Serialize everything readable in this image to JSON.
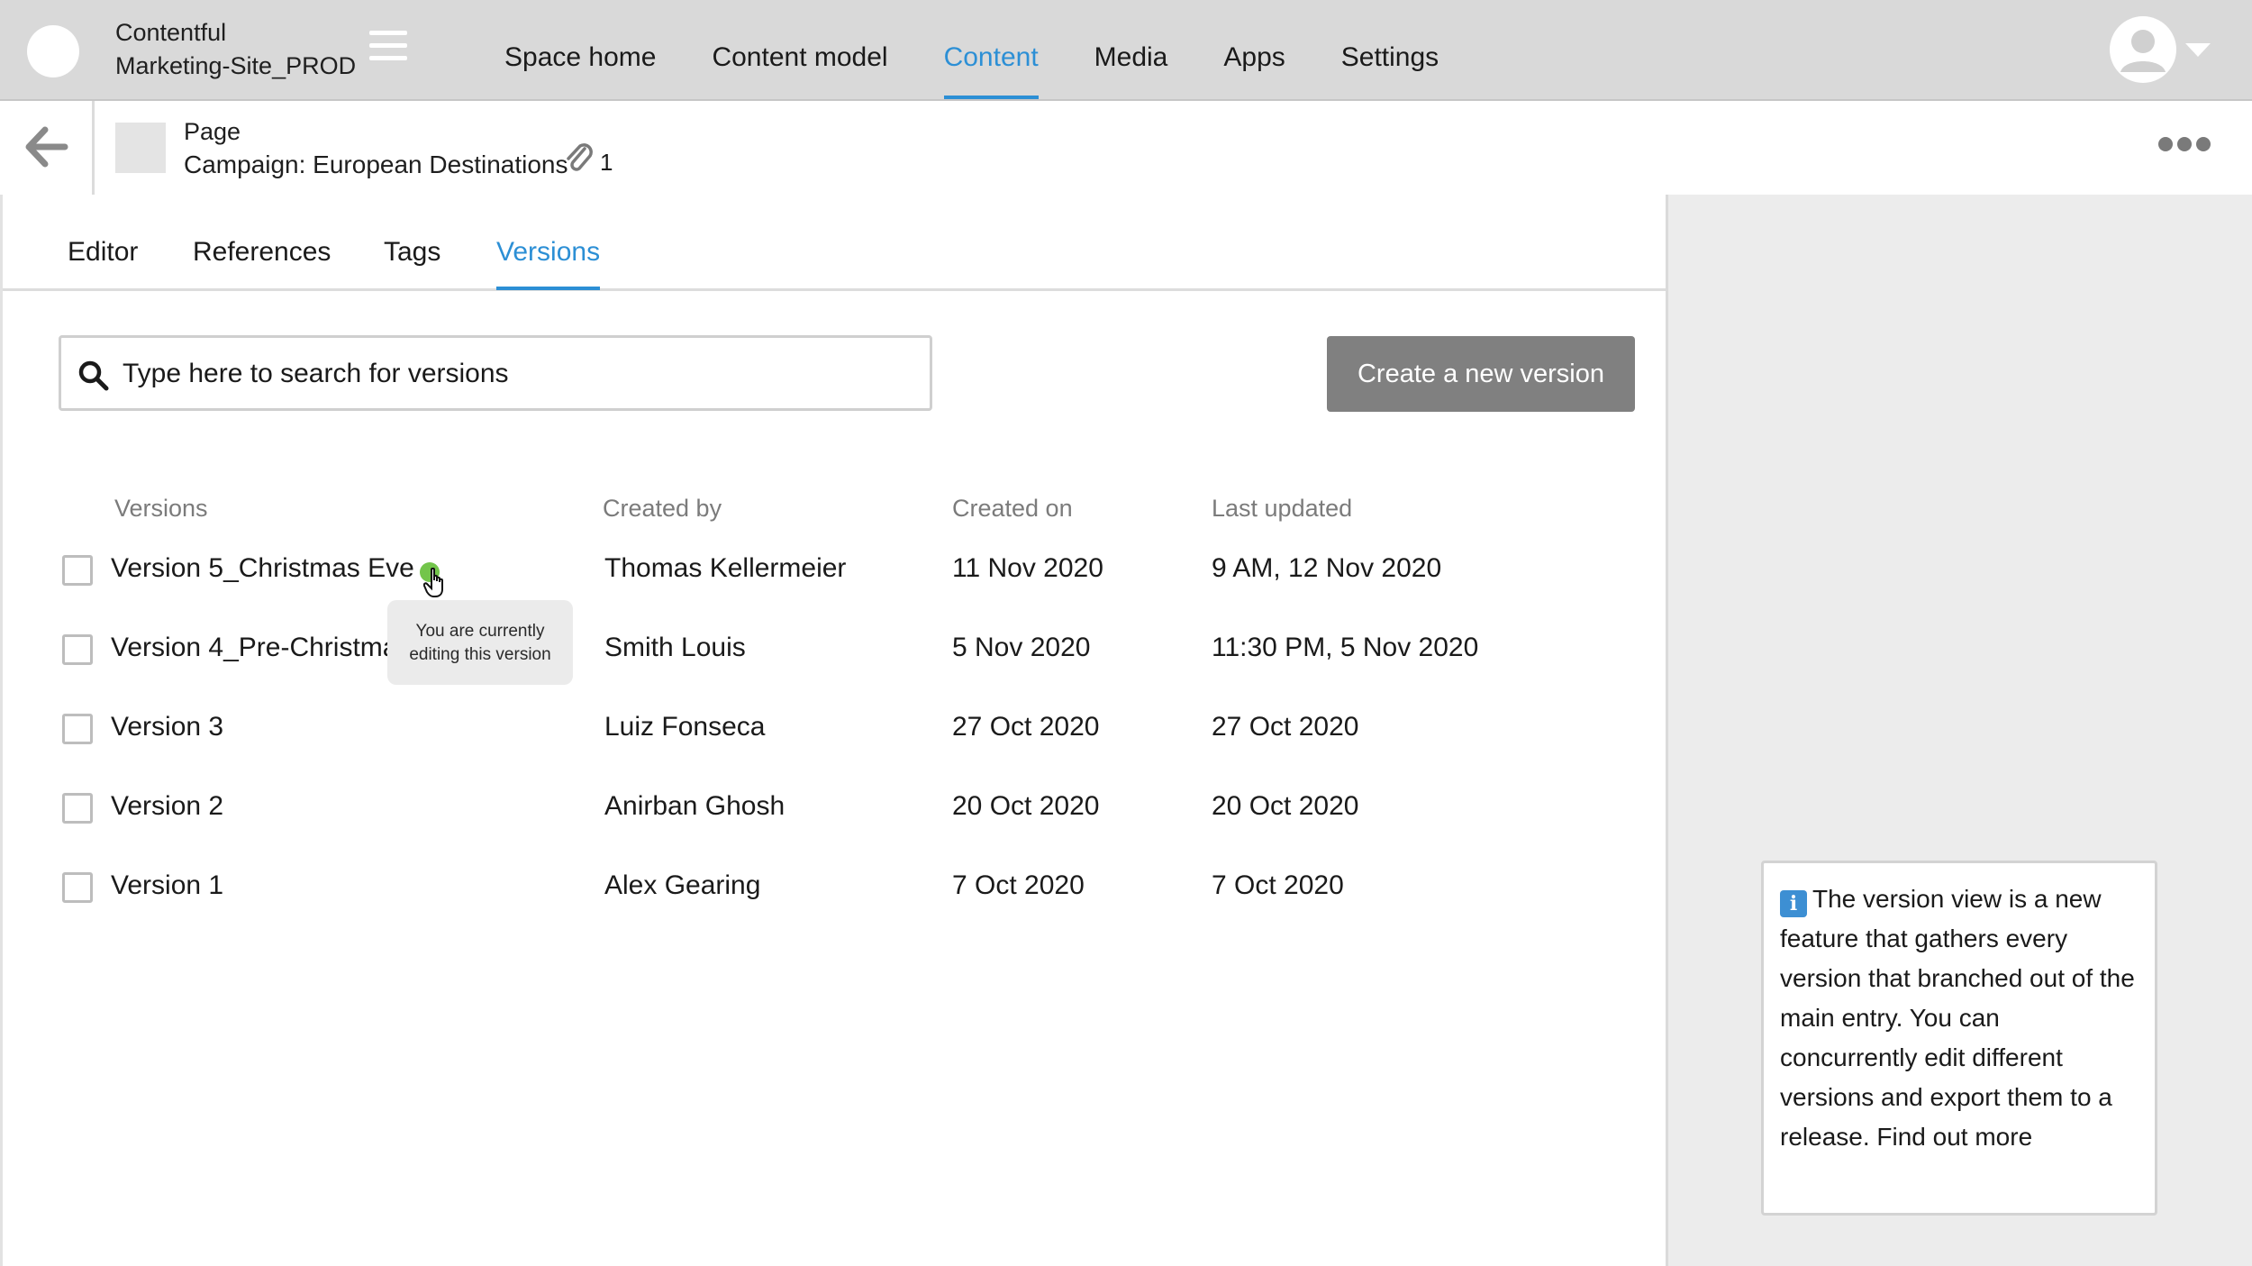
{
  "topbar": {
    "org_name": "Contentful",
    "space_name": "Marketing-Site_PROD",
    "nav": [
      {
        "label": "Space home",
        "active": false
      },
      {
        "label": "Content model",
        "active": false
      },
      {
        "label": "Content",
        "active": true
      },
      {
        "label": "Media",
        "active": false
      },
      {
        "label": "Apps",
        "active": false
      },
      {
        "label": "Settings",
        "active": false
      }
    ]
  },
  "entry": {
    "content_type": "Page",
    "title": "Campaign: European Destinations",
    "attachment_count": "1"
  },
  "tabs": [
    {
      "label": "Editor",
      "active": false
    },
    {
      "label": "References",
      "active": false
    },
    {
      "label": "Tags",
      "active": false
    },
    {
      "label": "Versions",
      "active": true
    }
  ],
  "search": {
    "placeholder": "Type here to search for versions",
    "value": ""
  },
  "create_button_label": "Create a new version",
  "table": {
    "headers": {
      "version": "Versions",
      "created_by": "Created by",
      "created_on": "Created on",
      "last_updated": "Last updated"
    },
    "rows": [
      {
        "name": "Version 5_Christmas Eve",
        "created_by": "Thomas Kellermeier",
        "created_on": "11 Nov 2020",
        "last_updated": "9 AM, 12 Nov 2020",
        "current": true
      },
      {
        "name": "Version 4_Pre-Christmas",
        "created_by": "Smith Louis",
        "created_on": "5 Nov 2020",
        "last_updated": "11:30 PM, 5 Nov 2020",
        "current": false
      },
      {
        "name": "Version 3",
        "created_by": "Luiz Fonseca",
        "created_on": "27 Oct 2020",
        "last_updated": "27 Oct 2020",
        "current": false
      },
      {
        "name": "Version 2",
        "created_by": "Anirban Ghosh",
        "created_on": "20 Oct 2020",
        "last_updated": "20 Oct 2020",
        "current": false
      },
      {
        "name": "Version 1",
        "created_by": "Alex Gearing",
        "created_on": "7 Oct 2020",
        "last_updated": "7 Oct 2020",
        "current": false
      }
    ]
  },
  "tooltip": {
    "line1": "You are currently",
    "line2": "editing this version"
  },
  "info_panel": {
    "icon": "info-icon",
    "text": "The version view is a new feature that gathers every version that branched out of the main entry. You can concurrently edit different versions and export them to a release. Find out more"
  },
  "colors": {
    "accent": "#2c8fd5",
    "current_indicator": "#73c54b",
    "topbar_bg": "#d9d9d9",
    "button_bg": "#808080"
  }
}
